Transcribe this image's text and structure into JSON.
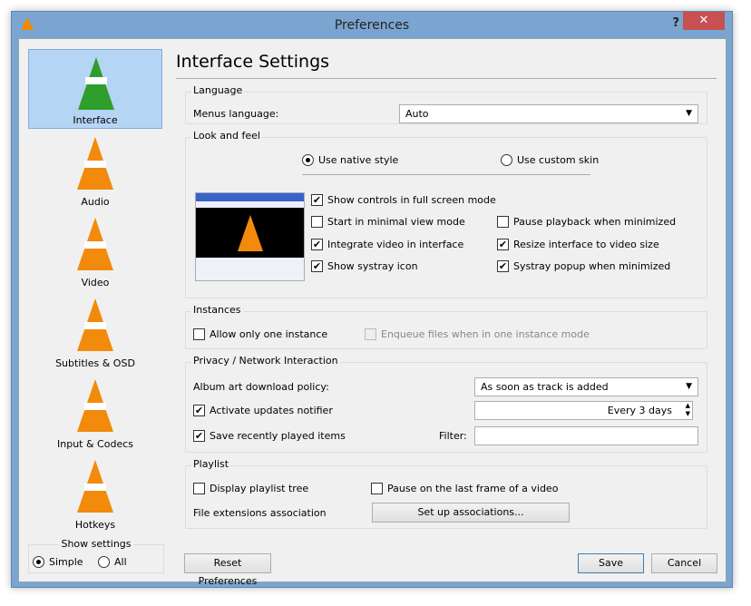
{
  "window": {
    "title": "Preferences",
    "help": "?",
    "close": "✕"
  },
  "sidebar": {
    "items": [
      {
        "label": "Interface"
      },
      {
        "label": "Audio"
      },
      {
        "label": "Video"
      },
      {
        "label": "Subtitles & OSD"
      },
      {
        "label": "Input & Codecs"
      },
      {
        "label": "Hotkeys"
      }
    ],
    "show_settings": {
      "label": "Show settings",
      "options": [
        "Simple",
        "All"
      ],
      "selected": "Simple"
    }
  },
  "main": {
    "title": "Interface Settings",
    "language": {
      "label": "Language",
      "menus_label": "Menus language:",
      "menus_value": "Auto"
    },
    "look": {
      "label": "Look and feel",
      "native": "Use native style",
      "custom": "Use custom skin",
      "selected": "native",
      "options": [
        {
          "label": "Show controls in full screen mode",
          "checked": true
        },
        {
          "label": "Start in minimal view mode",
          "checked": false
        },
        {
          "label": "Pause playback when minimized",
          "checked": false
        },
        {
          "label": "Integrate video in interface",
          "checked": true
        },
        {
          "label": "Resize interface to video size",
          "checked": true
        },
        {
          "label": "Show systray icon",
          "checked": true
        },
        {
          "label": "Systray popup when minimized",
          "checked": true
        }
      ]
    },
    "instances": {
      "label": "Instances",
      "one": "Allow only one instance",
      "one_checked": false,
      "enqueue": "Enqueue files when in one instance mode",
      "enqueue_checked": false
    },
    "privacy": {
      "label": "Privacy / Network Interaction",
      "album_label": "Album art download policy:",
      "album_value": "As soon as track is added",
      "updates": "Activate updates notifier",
      "updates_checked": true,
      "updates_interval": "Every 3 days",
      "recent": "Save recently played items",
      "recent_checked": true,
      "filter_label": "Filter:",
      "filter_value": ""
    },
    "playlist": {
      "label": "Playlist",
      "tree": "Display playlist tree",
      "tree_checked": false,
      "pause_last": "Pause on the last frame of a video",
      "pause_last_checked": false,
      "ext_label": "File extensions association",
      "ext_button": "Set up associations..."
    }
  },
  "footer": {
    "reset": "Reset Preferences",
    "save": "Save",
    "cancel": "Cancel"
  }
}
